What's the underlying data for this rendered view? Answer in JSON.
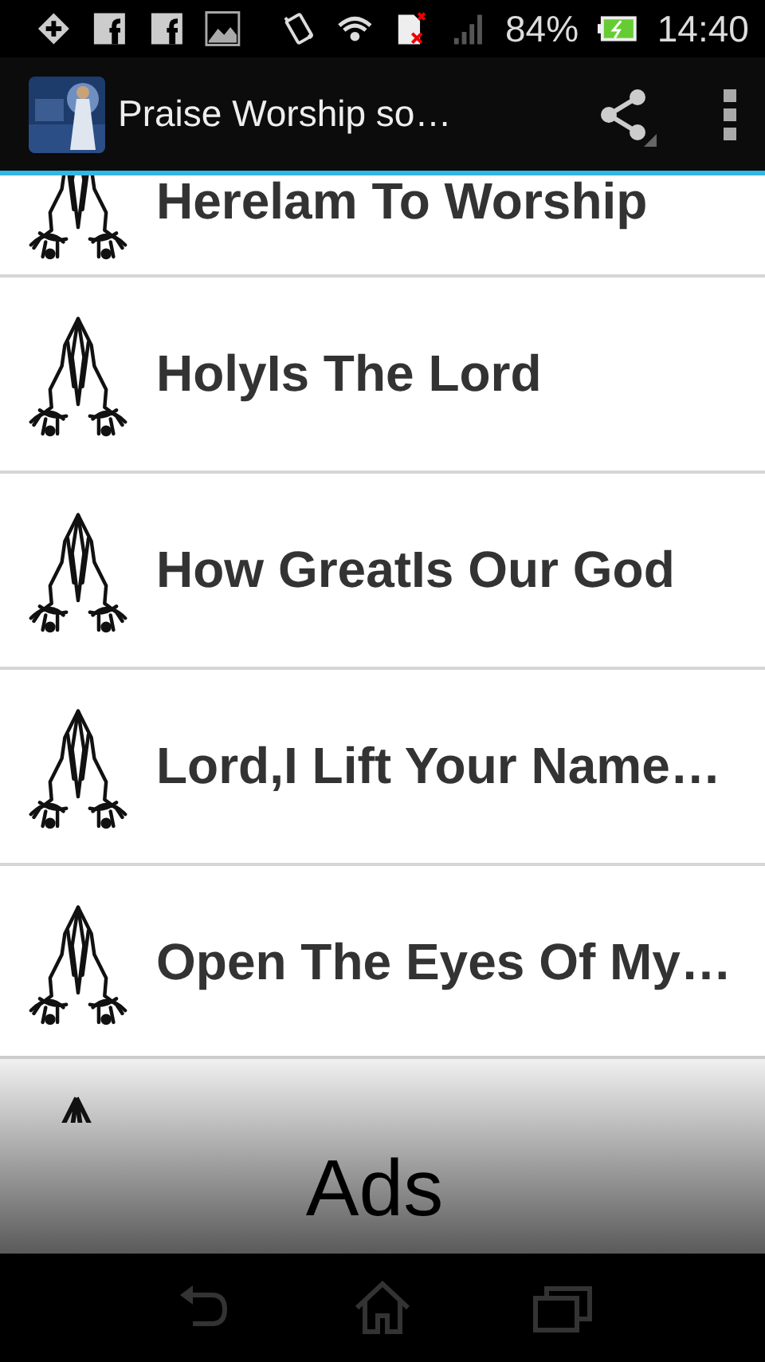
{
  "status_bar": {
    "battery": "84%",
    "time": "14:40"
  },
  "action_bar": {
    "title": "Praise Worship so…"
  },
  "songs": [
    {
      "title": "Herelam To Worship"
    },
    {
      "title": "HolyIs The Lord"
    },
    {
      "title": "How GreatIs Our God"
    },
    {
      "title": "Lord,I Lift Your Name…"
    },
    {
      "title": "Open The Eyes Of My…"
    }
  ],
  "ad_banner": {
    "label": "Ads"
  }
}
